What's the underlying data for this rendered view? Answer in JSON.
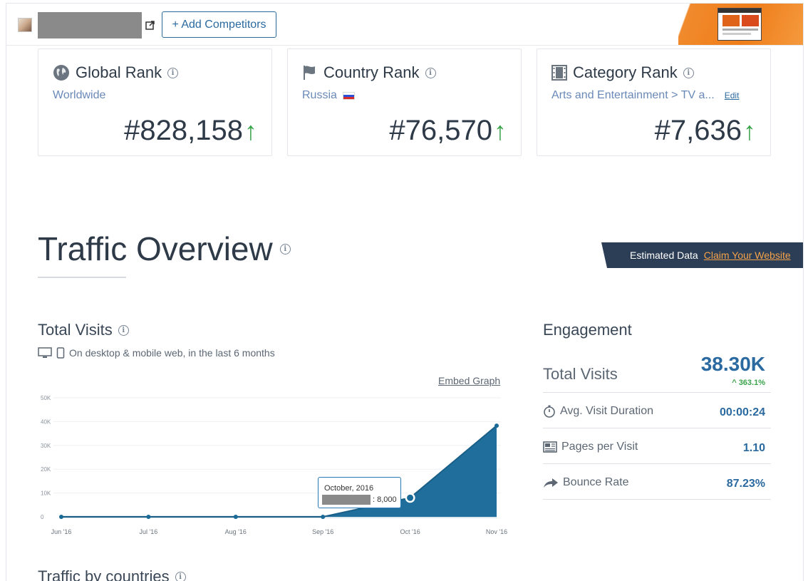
{
  "header": {
    "add_competitors_label": "+ Add Competitors"
  },
  "ranks": {
    "global": {
      "title": "Global Rank",
      "subtitle": "Worldwide",
      "value": "#828,158",
      "trend": "up"
    },
    "country": {
      "title": "Country Rank",
      "subtitle": "Russia",
      "value": "#76,570",
      "trend": "up"
    },
    "category": {
      "title": "Category Rank",
      "subtitle": "Arts and Entertainment > TV a...",
      "edit_label": "Edit",
      "value": "#7,636",
      "trend": "up"
    }
  },
  "traffic_overview": {
    "title": "Traffic Overview",
    "banner_text": "Estimated Data",
    "banner_link": "Claim Your Website"
  },
  "total_visits": {
    "title": "Total Visits",
    "subtitle": "On desktop & mobile web, in the last 6 months",
    "embed_label": "Embed Graph",
    "tooltip_month": "October, 2016",
    "tooltip_value": ": 8,000"
  },
  "chart_data": {
    "type": "area",
    "categories": [
      "Jun '16",
      "Jul '16",
      "Aug '16",
      "Sep '16",
      "Oct '16",
      "Nov '16"
    ],
    "values": [
      0,
      0,
      0,
      0,
      8000,
      38300
    ],
    "y_ticks": [
      "0",
      "10K",
      "20K",
      "30K",
      "40K",
      "50K"
    ],
    "ylim": [
      0,
      50000
    ],
    "color": "#1f6e9c",
    "grid": true
  },
  "engagement": {
    "title": "Engagement",
    "total_visits_label": "Total Visits",
    "total_visits_value": "38.30K",
    "total_visits_change": "363.1%",
    "duration_label": "Avg. Visit Duration",
    "duration_value": "00:00:24",
    "ppv_label": "Pages per Visit",
    "ppv_value": "1.10",
    "bounce_label": "Bounce Rate",
    "bounce_value": "87.23%"
  },
  "countries": {
    "title": "Traffic by countries"
  },
  "colors": {
    "accent": "#2b6aa0",
    "positive": "#3aa34a",
    "banner": "#2c3e55",
    "link_orange": "#f4a24a"
  }
}
